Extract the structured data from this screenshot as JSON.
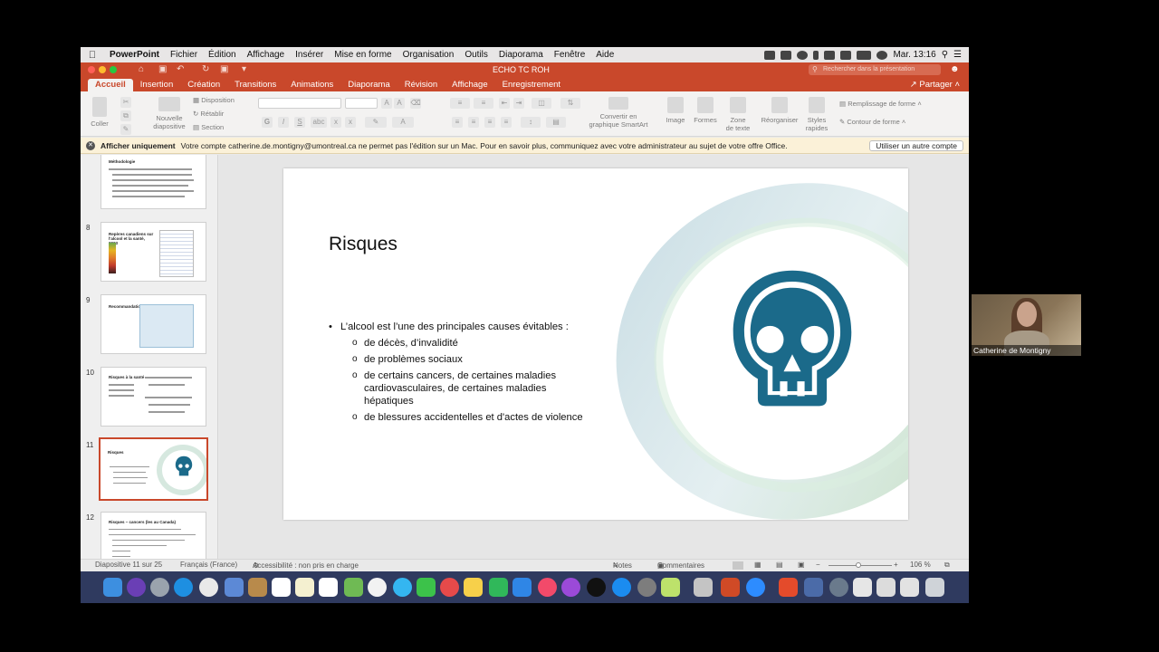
{
  "menubar": {
    "app": "PowerPoint",
    "items": [
      "Fichier",
      "Édition",
      "Affichage",
      "Insérer",
      "Mise en forme",
      "Organisation",
      "Outils",
      "Diaporama",
      "Fenêtre",
      "Aide"
    ],
    "clock": "Mar. 13:16"
  },
  "window": {
    "title": "ECHO TC ROH",
    "search_placeholder": "Rechercher dans la présentation"
  },
  "tabs": [
    "Accueil",
    "Insertion",
    "Création",
    "Transitions",
    "Animations",
    "Diaporama",
    "Révision",
    "Affichage",
    "Enregistrement"
  ],
  "share": "Partager",
  "ribbon": {
    "coller": "Coller",
    "nouvelle": "Nouvelle",
    "diapositive": "diapositive",
    "disposition": "Disposition",
    "retablir": "Rétablir",
    "section": "Section",
    "smartart1": "Convertir en",
    "smartart2": "graphique SmartArt",
    "image": "Image",
    "formes": "Formes",
    "zone1": "Zone",
    "zone2": "de texte",
    "reorganiser": "Réorganiser",
    "styles1": "Styles",
    "styles2": "rapides",
    "remplissage": "Remplissage de forme",
    "contour": "Contour de forme"
  },
  "infobar": {
    "label": "Afficher uniquement",
    "message": "Votre compte catherine.de.montigny@umontreal.ca ne permet pas l'édition sur un Mac. Pour en savoir plus, communiquez avec votre administrateur au sujet de votre offre Office.",
    "button": "Utiliser un autre compte"
  },
  "thumbnails": [
    {
      "num": "8",
      "title": "Repères canadiens sur l'alcool et la santé, 2023"
    },
    {
      "num": "9",
      "title": "Recommandations"
    },
    {
      "num": "10",
      "title": "Risques à la santé"
    },
    {
      "num": "11",
      "title": "Risques"
    },
    {
      "num": "12",
      "title": "Risques – cancers (les au Canada)"
    }
  ],
  "thumb_top": {
    "title": "Méthodologie"
  },
  "slide": {
    "title": "Risques",
    "bullet": "L’alcool est l’une des principales causes évitables :",
    "subbullets": [
      "de décès, d’invalidité",
      "de problèmes sociaux",
      "de certains cancers, de certaines maladies cardiovasculaires, de certaines maladies hépatiques",
      "de blessures accidentelles et d'actes de violence"
    ],
    "icon": "skull-icon",
    "icon_color": "#1b6a8a"
  },
  "statusbar": {
    "slide_count": "Diapositive 11 sur 25",
    "language": "Français (France)",
    "accessibility": "Accessibilité : non pris en charge",
    "notes": "Notes",
    "comments": "Commentaires",
    "zoom": "106 %"
  },
  "video": {
    "name": "Catherine de Montigny"
  },
  "colors": {
    "accent": "#c9482b",
    "infobar": "#fbf1d8",
    "dock": "#2f3a5f"
  }
}
